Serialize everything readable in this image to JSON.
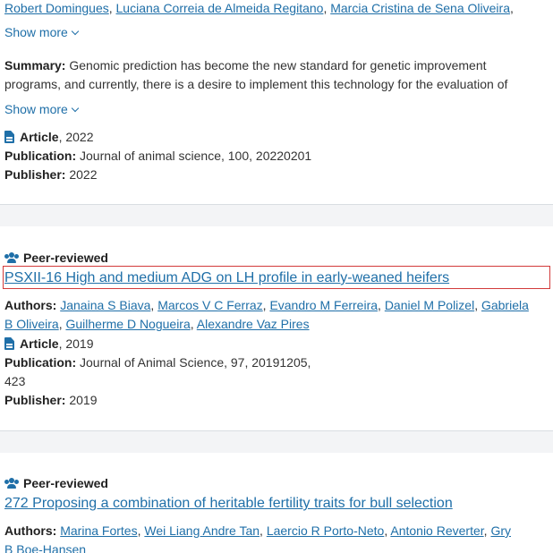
{
  "card1": {
    "authors_tail": [
      "Robert Domingues",
      "Luciana Correia de Almeida Regitano",
      "Marcia Cristina de Sena Oliveira"
    ],
    "show_more_1": "Show more",
    "summary_label": "Summary:",
    "summary_line1": "Genomic prediction has become the new standard for genetic improvement",
    "summary_line2": "programs, and currently, there is a desire to implement this technology for the evaluation of",
    "show_more_2": "Show more",
    "type_label": "Article",
    "type_year": ", 2022",
    "publication_label": "Publication:",
    "publication_value": "Journal of animal science, 100, 20220201",
    "publisher_label": "Publisher:",
    "publisher_value": "2022"
  },
  "card2": {
    "peer_label": "Peer-reviewed",
    "title": "PSXII-16 High and medium ADG on LH profile in early-weaned heifers",
    "authors_label": "Authors:",
    "authors": [
      "Janaina S Biava",
      "Marcos V C Ferraz",
      "Evandro M Ferreira",
      "Daniel M Polizel",
      "Gabriela",
      "B Oliveira",
      "Guilherme D Nogueira",
      "Alexandre Vaz Pires"
    ],
    "type_label": "Article",
    "type_year": ", 2019",
    "publication_label": "Publication:",
    "publication_value": "Journal of Animal Science, 97, 20191205,",
    "publication_value2": "423",
    "publisher_label": "Publisher:",
    "publisher_value": "2019"
  },
  "card3": {
    "peer_label": "Peer-reviewed",
    "title": "272 Proposing a combination of heritable fertility traits for bull selection",
    "authors_label": "Authors:",
    "authors": [
      "Marina Fortes",
      "Wei Liang Andre Tan",
      "Laercio R Porto-Neto",
      "Antonio Reverter",
      "Gry",
      "B Boe-Hansen"
    ]
  },
  "colors": {
    "link": "#1f6fa8",
    "highlight": "#d23a3a",
    "separator": "#f3f4f6"
  },
  "icons": {
    "document": "document-icon",
    "peer": "peer-reviewed-icon",
    "chevron": "chevron-down-icon"
  }
}
